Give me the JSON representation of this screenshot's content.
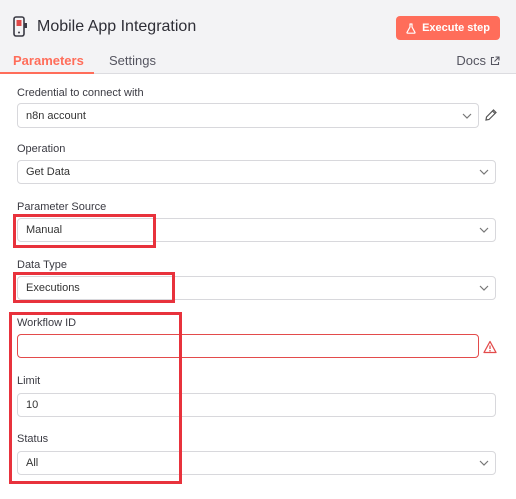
{
  "header": {
    "title": "Mobile App Integration",
    "execute_label": "Execute step"
  },
  "tabs": {
    "parameters": "Parameters",
    "settings": "Settings",
    "docs": "Docs"
  },
  "fields": {
    "credential": {
      "label": "Credential to connect with",
      "value": "n8n account"
    },
    "operation": {
      "label": "Operation",
      "value": "Get Data"
    },
    "parameter_source": {
      "label": "Parameter Source",
      "value": "Manual"
    },
    "data_type": {
      "label": "Data Type",
      "value": "Executions"
    },
    "workflow_id": {
      "label": "Workflow ID",
      "value": ""
    },
    "limit": {
      "label": "Limit",
      "value": "10"
    },
    "status": {
      "label": "Status",
      "value": "All"
    }
  },
  "colors": {
    "accent": "#ff6d5a",
    "highlight": "#e8323c",
    "error": "#e34b4b"
  },
  "icons": [
    "mobile-node-icon",
    "flask-icon",
    "external-link-icon",
    "chevron-down-icon",
    "pencil-icon",
    "warning-icon"
  ]
}
